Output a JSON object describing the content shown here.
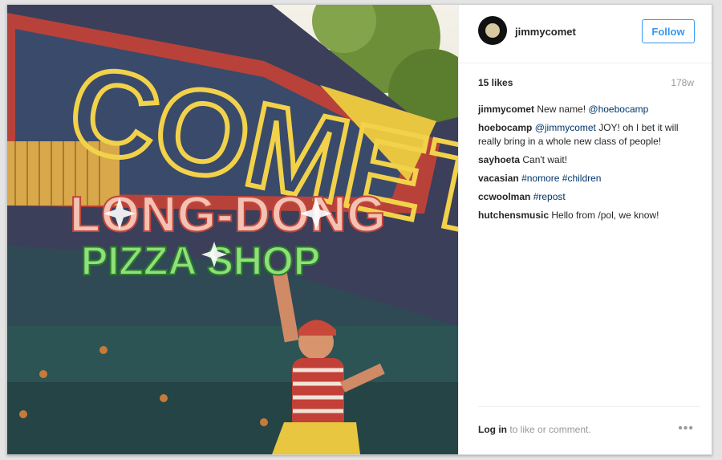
{
  "photo": {
    "sign_main": "COMET",
    "overlay_line1": "LONG-DONG",
    "overlay_line2": "PIZZA SHOP"
  },
  "header": {
    "username": "jimmycomet",
    "follow_label": "Follow"
  },
  "stats": {
    "likes": "15 likes",
    "age": "178w"
  },
  "comments": [
    {
      "user": "jimmycomet",
      "parts": [
        {
          "text": "New name! "
        },
        {
          "text": "@hoebocamp",
          "tag": true
        }
      ]
    },
    {
      "user": "hoebocamp",
      "parts": [
        {
          "text": "@jimmycomet",
          "tag": true
        },
        {
          "text": " JOY! oh I bet it will really bring in a whole new class of people!"
        }
      ]
    },
    {
      "user": "sayhoeta",
      "parts": [
        {
          "text": "Can't wait!"
        }
      ]
    },
    {
      "user": "vacasian",
      "parts": [
        {
          "text": "#nomore",
          "tag": true
        },
        {
          "text": " "
        },
        {
          "text": "#children",
          "tag": true
        }
      ]
    },
    {
      "user": "ccwoolman",
      "parts": [
        {
          "text": "#repost",
          "tag": true
        }
      ]
    },
    {
      "user": "hutchensmusic",
      "parts": [
        {
          "text": "Hello from /pol, we know!"
        }
      ]
    }
  ],
  "footer": {
    "login_link": "Log in",
    "login_rest": " to like or comment.",
    "more_label": "•••"
  },
  "colors": {
    "link_blue": "#3897f0",
    "tag_blue": "#003569"
  }
}
